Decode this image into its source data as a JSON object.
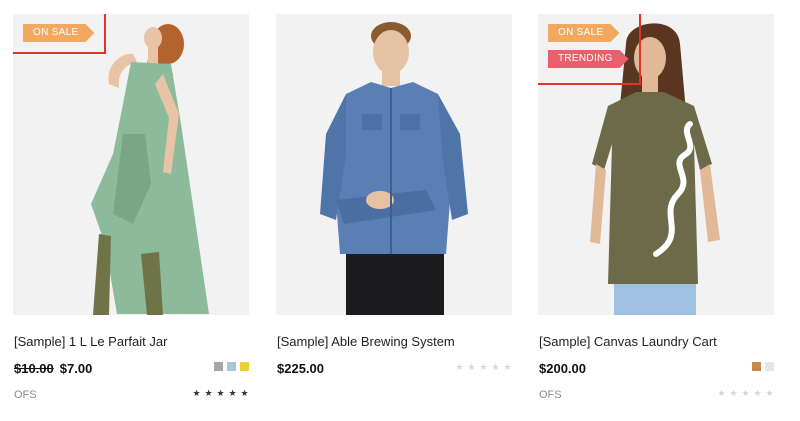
{
  "products": [
    {
      "title": "[Sample] 1 L Le Parfait Jar",
      "price_old": "$10.00",
      "price": "$7.00",
      "ofs_label": "OFS",
      "badges": [
        "ON SALE"
      ],
      "swatches": [
        "#a6a6a6",
        "#a9c6d8",
        "#e4d431"
      ],
      "rating": 5,
      "photo_subject": "woman in sage green sleeveless dress"
    },
    {
      "title": "[Sample] Able Brewing System",
      "price": "$225.00",
      "badges": [],
      "swatches": [],
      "rating": 0,
      "photo_subject": "man in denim shirt"
    },
    {
      "title": "[Sample] Canvas Laundry Cart",
      "price": "$200.00",
      "ofs_label": "OFS",
      "badges": [
        "ON SALE",
        "TRENDING"
      ],
      "swatches": [
        "#c7884a",
        "#e6e6e6"
      ],
      "rating": 0,
      "photo_subject": "woman in olive 'nice' t-shirt"
    }
  ],
  "colors": {
    "sale_badge": "#f0a95e",
    "trending_badge": "#eb5e6c",
    "highlight_outline": "#e0342b",
    "star_filled": "#333333",
    "star_empty": "#d8d8d8"
  },
  "star_glyph": "★"
}
